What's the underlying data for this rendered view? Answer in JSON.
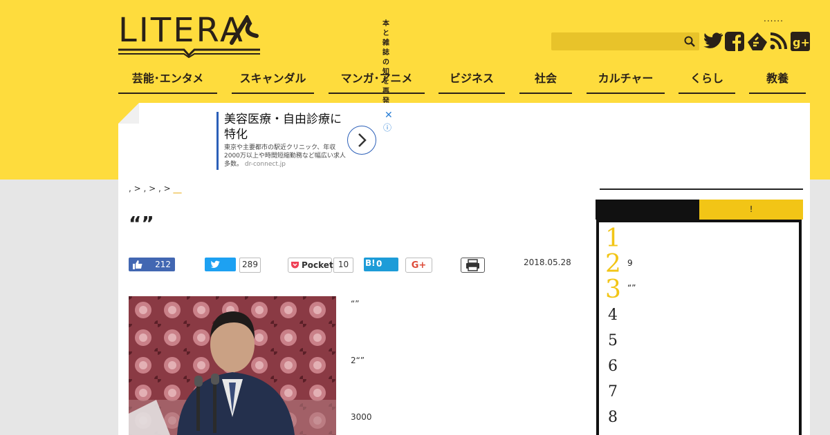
{
  "site": {
    "logo_text": "LITERA",
    "tagline_line1": "本と雑誌の",
    "tagline_line2": "知を再発見",
    "dots": "......"
  },
  "search": {
    "placeholder": ""
  },
  "social_icons": [
    "twitter-icon",
    "facebook-icon",
    "feedly-icon",
    "rss-icon",
    "google-plus-icon"
  ],
  "nav": {
    "items": [
      {
        "label": "芸能･エンタメ"
      },
      {
        "label": "スキャンダル"
      },
      {
        "label": "マンガ･アニメ"
      },
      {
        "label": "ビジネス"
      },
      {
        "label": "社会"
      },
      {
        "label": "カルチャー"
      },
      {
        "label": "くらし"
      },
      {
        "label": "教養"
      }
    ]
  },
  "ad": {
    "title": "美容医療・自由診療に特化",
    "body": "東京や主要都市の駅近クリニック、年収2000万以上や時間短縮勤務など幅広い求人多数。",
    "domain": "dr-connect.jp",
    "close": "✕",
    "info": "ⓘ"
  },
  "breadcrumb": {
    "sep1": ", > ",
    "sep2": ", > ",
    "sep3": ", > ",
    "tail": "__"
  },
  "article": {
    "headline": "“”",
    "date": "2018.05.28",
    "paragraphs": [
      "“”",
      "2“”",
      "3000"
    ]
  },
  "share": {
    "fb_count": "212",
    "tw_count": "289",
    "pocket_label": "Pocket",
    "pocket_count": "10",
    "hatena_label": "B!",
    "hatena_count": "0",
    "gplus_label": "G+"
  },
  "sidebar": {
    "tab_yellow_label": "!",
    "ranking": [
      {
        "num": "1",
        "text": ""
      },
      {
        "num": "2",
        "text": "9"
      },
      {
        "num": "3",
        "text": "“”"
      },
      {
        "num": "4",
        "text": ""
      },
      {
        "num": "5",
        "text": ""
      },
      {
        "num": "6",
        "text": ""
      },
      {
        "num": "7",
        "text": ""
      },
      {
        "num": "8",
        "text": ""
      }
    ]
  },
  "colors": {
    "brand_yellow": "#fedc3d",
    "accent_yellow": "#f2c516",
    "dark": "#2a2118",
    "facebook": "#4267b2",
    "twitter": "#1da1f2",
    "hatena": "#1d9cd8"
  }
}
